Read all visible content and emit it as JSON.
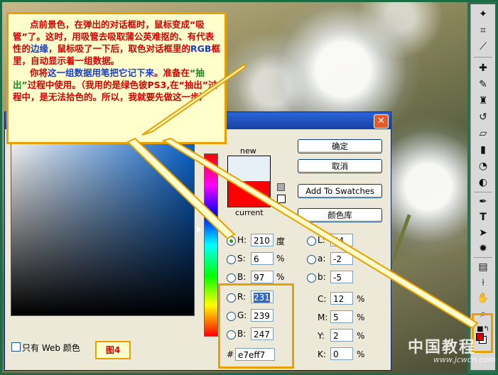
{
  "annotation": {
    "line1": "点前景色，在弹出的对话框时，鼠标变成“吸管”了。这时，用吸管去吸取蒲公英难抠的、有代表性的",
    "line1_blue": "边缘",
    "line1_rest": "，鼠标吸了一下后，取色对话框里的",
    "rgb_word": "RGB",
    "line1_end": "框里，自动显示着一组数据。",
    "line2_start": "你将",
    "line2_blue": "这一组数据用笔把它记下来",
    "line2_mid": "。准备在",
    "line2_green": "“抽出”",
    "line2_end": "过程中使用。（我用的是绿色彼PS3,在“抽出”过程中，是无法拾色的。所以，我就要先做这一步）"
  },
  "dialog": {
    "close_glyph": "✕",
    "new_label": "new",
    "current_label": "current",
    "ok_label": "确定",
    "cancel_label": "取消",
    "add_swatches_label": "Add To Swatches",
    "libraries_label": "颜色库",
    "web_only_label": "只有 Web 颜色",
    "hsb": [
      {
        "label": "H:",
        "value": "210",
        "unit": "度"
      },
      {
        "label": "S:",
        "value": "6",
        "unit": "%"
      },
      {
        "label": "B:",
        "value": "97",
        "unit": "%"
      }
    ],
    "lab": [
      {
        "label": "L:",
        "value": "94"
      },
      {
        "label": "a:",
        "value": "-2"
      },
      {
        "label": "b:",
        "value": "-5"
      }
    ],
    "rgb": [
      {
        "label": "R:",
        "value": "231"
      },
      {
        "label": "G:",
        "value": "239"
      },
      {
        "label": "B:",
        "value": "247"
      }
    ],
    "cmyk": [
      {
        "label": "C:",
        "value": "12",
        "unit": "%"
      },
      {
        "label": "M:",
        "value": "5",
        "unit": "%"
      },
      {
        "label": "Y:",
        "value": "2",
        "unit": "%"
      },
      {
        "label": "K:",
        "value": "0",
        "unit": "%"
      }
    ],
    "hex_label": "#",
    "hex_value": "e7eff7",
    "new_color": "#e7eff7",
    "current_color": "#ff0000"
  },
  "figure_label": "图4",
  "watermark": "中国教程",
  "watermark_url": "www.jcwcn.com",
  "colors": {
    "accent": "#e8a000",
    "note_text": "#d40000",
    "note_blue": "#1a3cc8",
    "title_bar": "#2a64d8"
  }
}
